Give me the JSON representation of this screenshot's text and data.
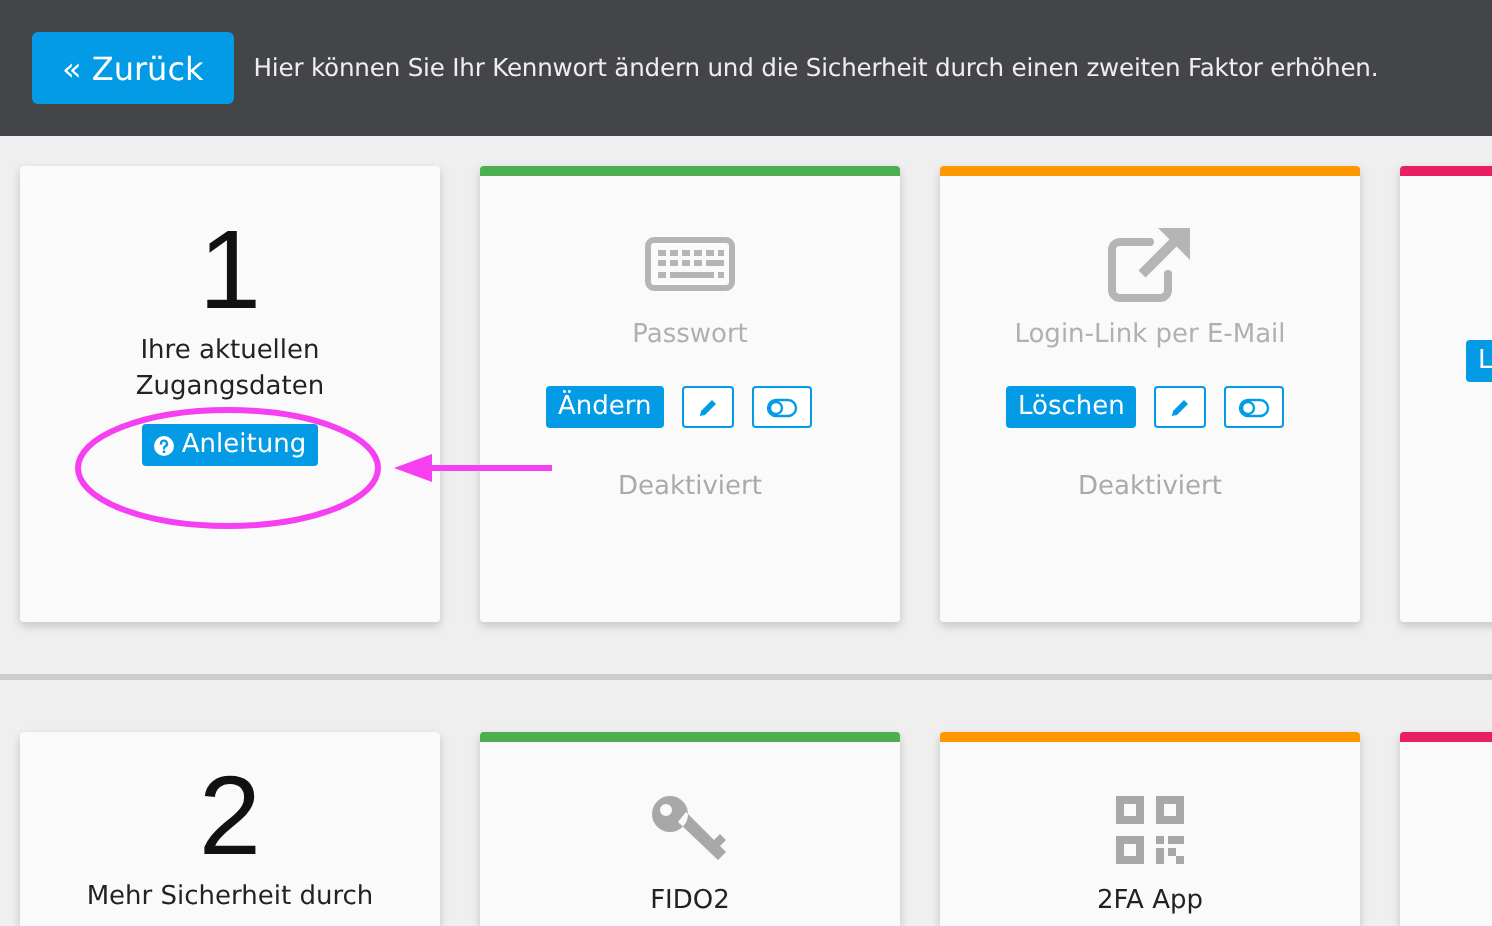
{
  "header": {
    "back_button": "« Zurück",
    "description": "Hier können Sie Ihr Kennwort ändern und die Sicherheit durch einen zweiten Faktor erhöhen."
  },
  "sections": [
    {
      "step": {
        "number": "1",
        "title": "Ihre aktuellen Zugangsdaten",
        "help_button": "Anleitung"
      },
      "methods": [
        {
          "color": "#4caf50",
          "kind": "keyboard",
          "title": "Passwort",
          "active": false,
          "action": "Ändern",
          "status": "Deaktiviert"
        },
        {
          "color": "#ff9800",
          "kind": "external-link",
          "title": "Login-Link per E-Mail",
          "active": false,
          "action": "Löschen",
          "status": "Deaktiviert"
        },
        {
          "color": "#e91e63",
          "kind": "blank",
          "action": "L"
        }
      ]
    },
    {
      "step": {
        "number": "2",
        "title": "Mehr Sicherheit durch"
      },
      "methods": [
        {
          "color": "#4caf50",
          "kind": "key",
          "title": "FIDO2",
          "active": true
        },
        {
          "color": "#ff9800",
          "kind": "qr-code",
          "title": "2FA App",
          "active": true
        },
        {
          "color": "#e91e63",
          "kind": "blank"
        }
      ]
    }
  ]
}
